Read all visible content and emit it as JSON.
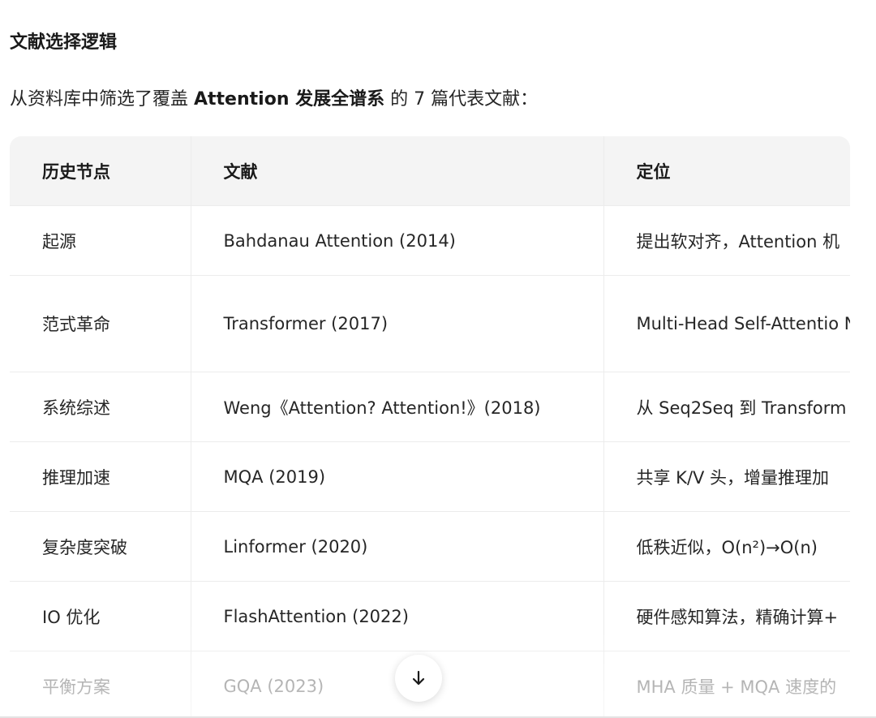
{
  "heading": "文献选择逻辑",
  "intro": {
    "prefix": "从资料库中筛选了覆盖 ",
    "bold": "Attention 发展全谱系",
    "suffix": " 的 7 篇代表文献："
  },
  "table": {
    "headers": [
      "历史节点",
      "文献",
      "定位"
    ],
    "rows": [
      [
        "起源",
        "Bahdanau Attention (2014)",
        "提出软对齐，Attention 机"
      ],
      [
        "范式革命",
        "Transformer (2017)",
        "Multi-Head Self-Attentio NN"
      ],
      [
        "系统综述",
        "Weng《Attention? Attention!》(2018)",
        "从 Seq2Seq 到 Transform"
      ],
      [
        "推理加速",
        "MQA (2019)",
        "共享 K/V 头，增量推理加"
      ],
      [
        "复杂度突破",
        "Linformer (2020)",
        "低秩近似，O(n²)→O(n)"
      ],
      [
        "IO 优化",
        "FlashAttention (2022)",
        "硬件感知算法，精确计算+"
      ],
      [
        "平衡方案",
        "GQA (2023)",
        "MHA 质量 + MQA 速度的"
      ]
    ]
  },
  "scroll_button": {
    "icon": "arrow-down-icon"
  }
}
